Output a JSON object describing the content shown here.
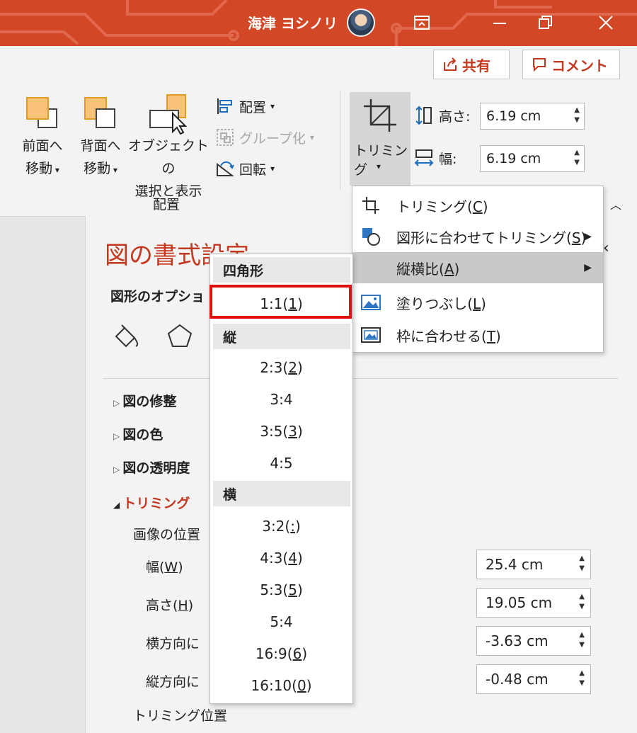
{
  "titlebar": {
    "user_name": "海津 ヨシノリ",
    "accent": "#d24726"
  },
  "ribbon": {
    "share_label": "共有",
    "comment_label": "コメント",
    "bring_forward": [
      "前面へ",
      "移動"
    ],
    "send_backward": [
      "背面へ",
      "移動"
    ],
    "selection_pane": [
      "オブジェクトの",
      "選択と表示"
    ],
    "align_label": "配置",
    "group_label": "グループ化",
    "rotate_label": "回転",
    "group_name": "配置",
    "crop_label": "トリミング",
    "height_label": "高さ:",
    "height_value": "6.19 cm",
    "width_label": "幅:",
    "width_value": "6.19 cm"
  },
  "crop_menu": {
    "items": [
      {
        "label": "トリミング(",
        "key": "C",
        "close": ")"
      },
      {
        "label": "図形に合わせてトリミング(",
        "key": "S",
        "close": ")"
      },
      {
        "label": "縦横比(",
        "key": "A",
        "close": ")"
      },
      {
        "label": "塗りつぶし(",
        "key": "L",
        "close": ")"
      },
      {
        "label": "枠に合わせる(",
        "key": "T",
        "close": ")"
      }
    ]
  },
  "aspect_menu": {
    "square_header": "四角形",
    "square": [
      {
        "text": "1:1(",
        "key": "1",
        "close": ")"
      }
    ],
    "portrait_header": "縦",
    "portrait": [
      {
        "text": "2:3(",
        "key": "2",
        "close": ")"
      },
      {
        "text": "3:4",
        "key": "",
        "close": ""
      },
      {
        "text": "3:5(",
        "key": "3",
        "close": ")"
      },
      {
        "text": "4:5",
        "key": "",
        "close": ""
      }
    ],
    "landscape_header": "横",
    "landscape": [
      {
        "text": "3:2(",
        "key": ":",
        "close": ")"
      },
      {
        "text": "4:3(",
        "key": "4",
        "close": ")"
      },
      {
        "text": "5:3(",
        "key": "5",
        "close": ")"
      },
      {
        "text": "5:4",
        "key": "",
        "close": ""
      },
      {
        "text": "16:9(",
        "key": "6",
        "close": ")"
      },
      {
        "text": "16:10(",
        "key": "0",
        "close": ")"
      }
    ]
  },
  "pane": {
    "title": "図の書式設定",
    "options_label": "図形のオプショ",
    "sections": [
      "図の修整",
      "図の色",
      "図の透明度"
    ],
    "crop_section": "トリミング",
    "image_position": "画像の位置",
    "rows": [
      {
        "label": "幅(",
        "key": "W",
        "close": ")",
        "value": "25.4 cm"
      },
      {
        "label": "高さ(",
        "key": "H",
        "close": ")",
        "value": "19.05 cm"
      },
      {
        "label": "横方向に",
        "key": "",
        "close": "",
        "value": "-3.63 cm"
      },
      {
        "label": "縦方向に",
        "key": "",
        "close": "",
        "value": "-0.48 cm"
      }
    ],
    "crop_position": "トリミング位置"
  }
}
